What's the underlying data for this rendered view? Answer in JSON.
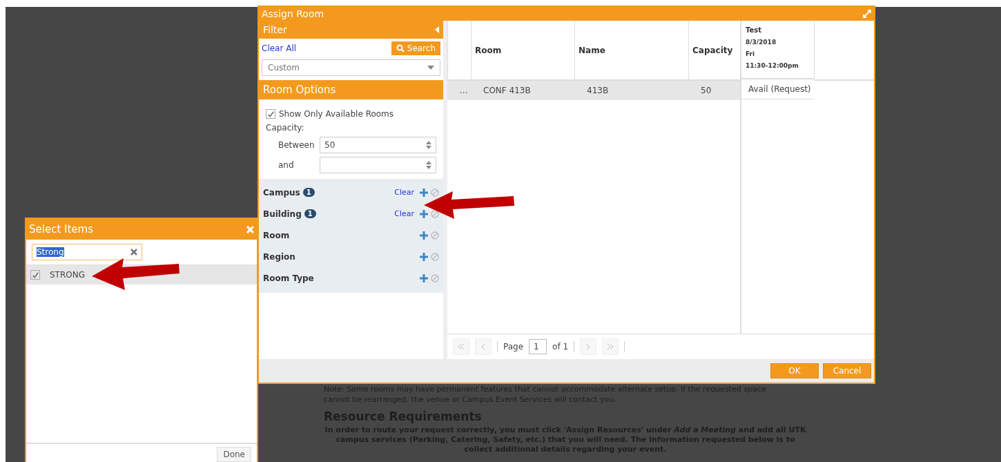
{
  "assign_room": {
    "title": "Assign Room",
    "filter": {
      "title": "Filter",
      "clear_all": "Clear All",
      "search_button": "Search",
      "preset": "Custom"
    },
    "room_options": {
      "title": "Room Options",
      "show_available": {
        "label": "Show Only Available Rooms",
        "checked": true
      },
      "capacity_label": "Capacity:",
      "between_label": "Between",
      "between_value": "50",
      "and_label": "and"
    },
    "facets": [
      {
        "label": "Campus",
        "count": "1",
        "clear": "Clear"
      },
      {
        "label": "Building",
        "count": "1",
        "clear": "Clear"
      },
      {
        "label": "Room"
      },
      {
        "label": "Region"
      },
      {
        "label": "Room Type"
      }
    ],
    "table": {
      "columns": [
        "Room",
        "Name",
        "Capacity"
      ],
      "schedule_header": [
        "Test",
        "8/3/2018",
        "Fri",
        "11:30-12:00pm"
      ],
      "rows": [
        {
          "more": "...",
          "room": "CONF 413B",
          "name": "413B",
          "capacity": "50",
          "availability": "Avail (Request)",
          "selected": true
        }
      ]
    },
    "pager": {
      "page_label": "Page",
      "page": "1",
      "of": "of 1"
    },
    "buttons": [
      "OK",
      "Cancel"
    ]
  },
  "select_items": {
    "title": "Select Items",
    "search_value": "Strong",
    "items": [
      {
        "label": "STRONG",
        "checked": true
      }
    ],
    "done": "Done"
  },
  "page": {
    "note_lines": [
      "Note: Some rooms may have permanent features that cannot accommodate alternate setup. If the requested space",
      "cannot be rearranged, the venue or Campus Event Services will contact you."
    ],
    "heading": "Resource Requirements",
    "instructions": "**In order to route your request correctly, you must click 'Assign Resources' under *Add a Meeting* and add all UTK campus services (Parking, Catering, Safety, etc.) that you will need. The information requested below is to collect additional details regarding your event.**"
  }
}
